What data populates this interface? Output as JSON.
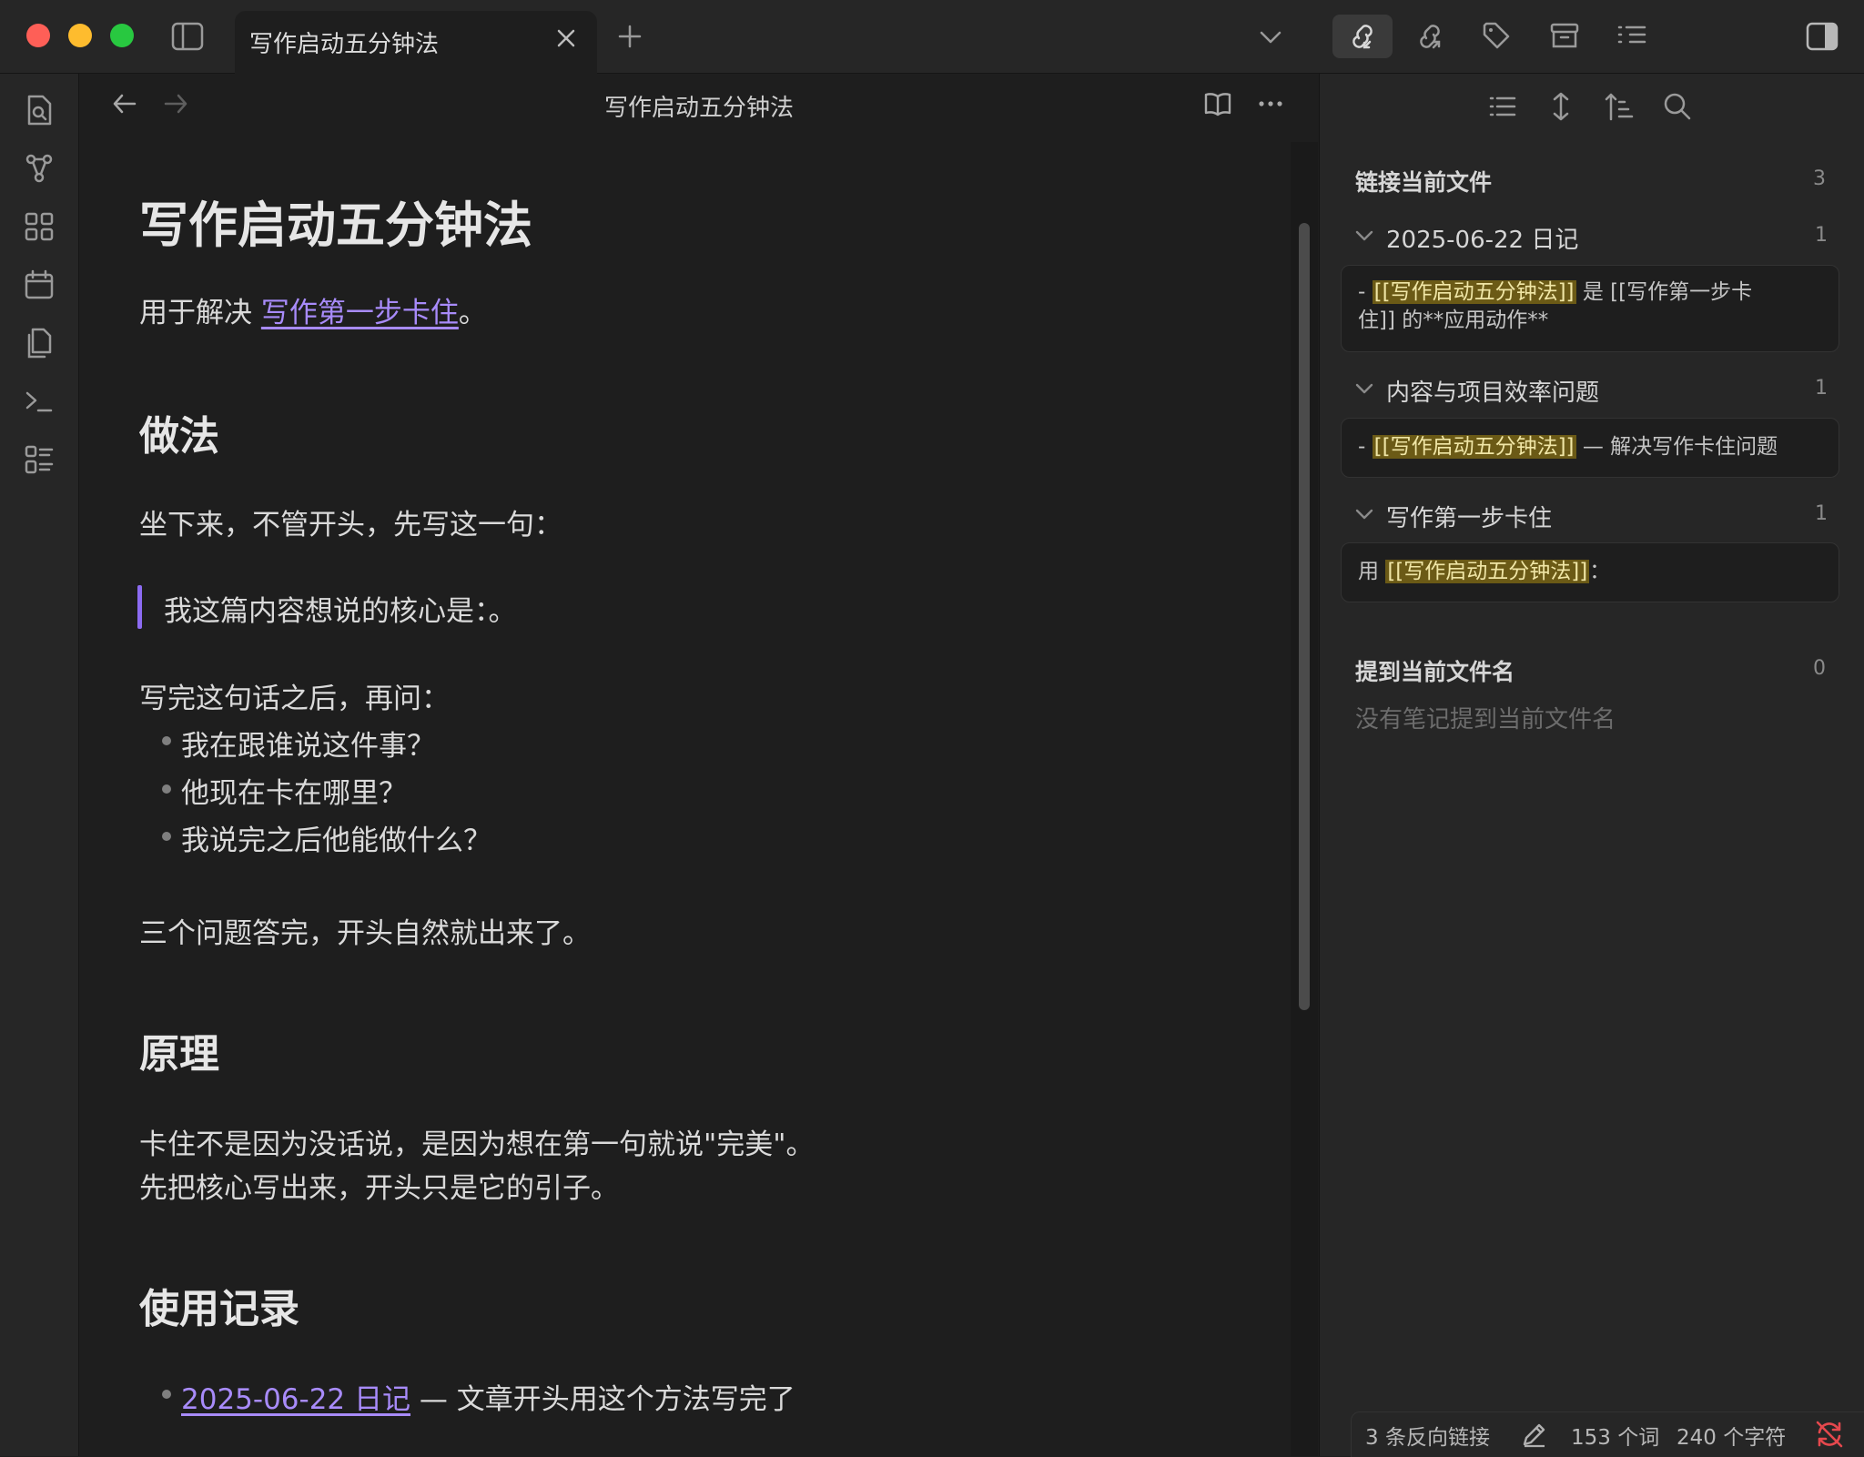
{
  "window": {
    "traffic_colors": {
      "close": "#fe5f57",
      "minimize": "#febc2e",
      "zoom": "#28c840"
    }
  },
  "tab": {
    "title": "写作启动五分钟法"
  },
  "titlebar_actions": {
    "icons": [
      "backlinks-icon",
      "outgoing-links-icon",
      "tags-icon",
      "archive-icon",
      "outline-icon"
    ]
  },
  "view_header": {
    "title": "写作启动五分钟法"
  },
  "document": {
    "title": "写作启动五分钟法",
    "intro_prefix": "用于解决 ",
    "intro_link": "写作第一步卡住",
    "intro_suffix": "。",
    "section1_heading": "做法",
    "section1_p1": "坐下来，不管开头，先写这一句：",
    "section1_quote": "我这篇内容想说的核心是：。",
    "section1_p2": "写完这句话之后，再问：",
    "section1_bullets": [
      "我在跟谁说这件事？",
      "他现在卡在哪里？",
      "我说完之后他能做什么？"
    ],
    "section1_p3": "三个问题答完，开头自然就出来了。",
    "section2_heading": "原理",
    "section2_line1": "卡住不是因为没话说，是因为想在第一句就说\"完美\"。",
    "section2_line2": "先把核心写出来，开头只是它的引子。",
    "section3_heading": "使用记录",
    "section3_item_link": "2025-06-22 日记",
    "section3_item_suffix": " — 文章开头用这个方法写完了"
  },
  "backlinks": {
    "linked": {
      "title": "链接当前文件",
      "count": "3",
      "groups": [
        {
          "name": "2025-06-22 日记",
          "count": "1",
          "pre": "- ",
          "hl": "[[写作启动五分钟法]]",
          "post": " 是 [[写作第一步卡住]] 的**应用动作**"
        },
        {
          "name": "内容与项目效率问题",
          "count": "1",
          "pre": "- ",
          "hl": "[[写作启动五分钟法]]",
          "post": " — 解决写作卡住问题"
        },
        {
          "name": "写作第一步卡住",
          "count": "1",
          "pre": "用 ",
          "hl": "[[写作启动五分钟法]]",
          "post": "："
        }
      ]
    },
    "unlinked": {
      "title": "提到当前文件名",
      "count": "0",
      "empty_text": "没有笔记提到当前文件名"
    }
  },
  "statusbar": {
    "backlinks": "3 条反向链接",
    "words": "153 个词",
    "chars": "240 个字符"
  },
  "colors": {
    "accent": "#a88bfa",
    "highlight": "#6b5a16",
    "sync_error": "#e5484d"
  }
}
